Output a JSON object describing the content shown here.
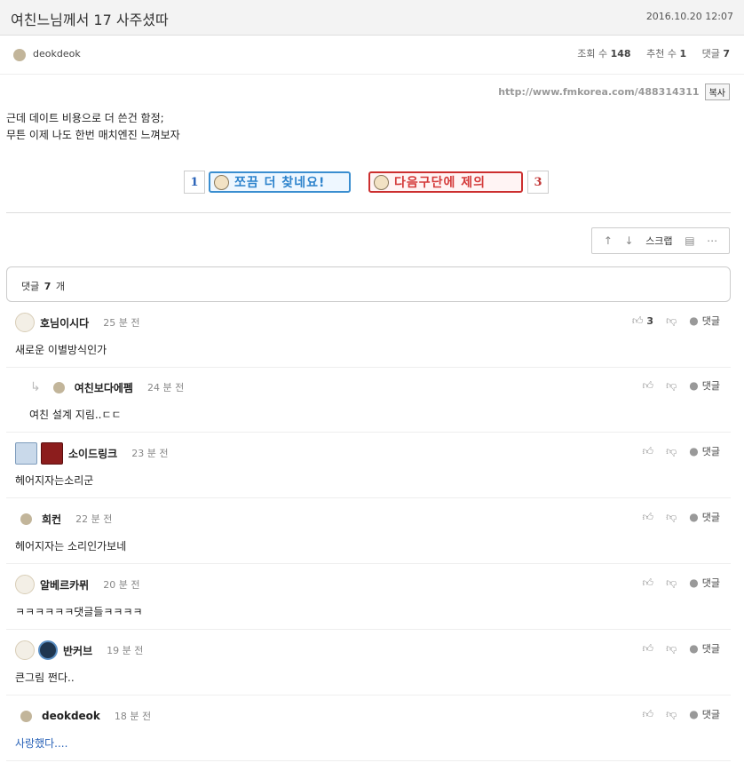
{
  "post": {
    "title": "여친느님께서 17 사주셨따",
    "date": "2016.10.20 12:07",
    "author": "deokdeok",
    "views_label": "조회 수",
    "views": "148",
    "recommend_label": "추천 수",
    "recommend": "1",
    "comments_label": "댓글",
    "comments": "7",
    "url": "http://www.fmkorea.com/488314311",
    "copy_label": "복사",
    "content": [
      "근데 데이트 비용으로 더 쓴건 함정;",
      "무튼 이제 나도 한번 매치엔진 느껴보자"
    ]
  },
  "pagination": {
    "prev_num": "1",
    "prev_label": "쪼끔 더 찾네요!",
    "next_label": "다음구단에 제의",
    "next_num": "3"
  },
  "toolbar": {
    "up_icon": "arrow-up-icon",
    "down_icon": "arrow-down-icon",
    "scrap_label": "스크랩",
    "chart_icon": "bar-chart-icon",
    "more_icon": "more-icon"
  },
  "comment_section": {
    "label": "댓글",
    "count": "7",
    "unit": "개"
  },
  "comments": [
    {
      "nick": "호님이시다",
      "time": "25 분 전",
      "text": "새로운 이별방식인가",
      "votes": "3",
      "reply_label": "댓글"
    },
    {
      "nick": "여친보다에펨",
      "time": "24 분 전",
      "text": "여친 설계 지림..ㄷㄷ",
      "votes": "",
      "reply_label": "댓글"
    },
    {
      "nick": "소이드링크",
      "time": "23 분 전",
      "text": "헤어지자는소리군",
      "votes": "",
      "reply_label": "댓글"
    },
    {
      "nick": "희컨",
      "time": "22 분 전",
      "text": "헤어지자는 소리인가보네",
      "votes": "",
      "reply_label": "댓글"
    },
    {
      "nick": "알베르카뮈",
      "time": "20 분 전",
      "text": "ㅋㅋㅋㅋㅋㅋ댓글들ㅋㅋㅋㅋ",
      "votes": "",
      "reply_label": "댓글"
    },
    {
      "nick": "반커브",
      "time": "19 분 전",
      "text": "큰그림 쩐다..",
      "votes": "",
      "reply_label": "댓글"
    },
    {
      "nick": "deokdeok",
      "time": "18 분 전",
      "text": "사랑했다....",
      "votes": "",
      "reply_label": "댓글"
    }
  ]
}
